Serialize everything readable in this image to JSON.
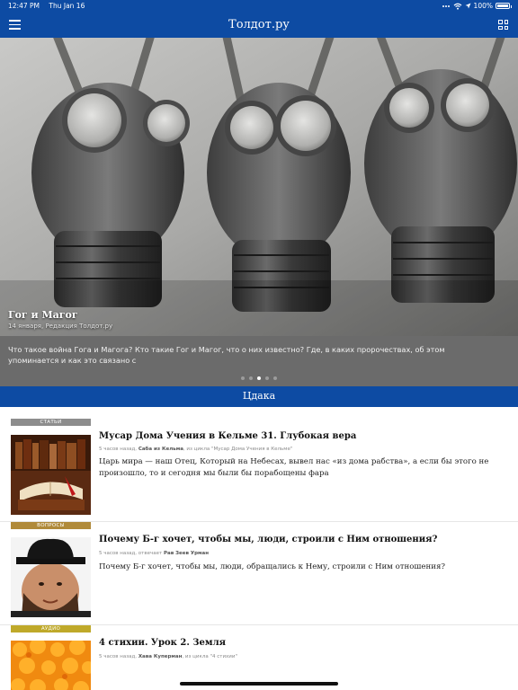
{
  "status_bar": {
    "time": "12:47 PM",
    "date": "Thu Jan 16",
    "battery": "100%"
  },
  "nav": {
    "title": "Толдот.ру",
    "menu_icon": "hamburger-icon",
    "grid_icon": "grid-icon"
  },
  "hero": {
    "title": "Гог и Магог",
    "subtitle": "14 января, Редакция Толдот.ру",
    "description": "Что такое война Гога и Магога? Кто такие Гог и Магог, что о них известно? Где, в каких пророчествах, об этом упоминается и как это связано с",
    "slides_total": 5,
    "slide_active": 3
  },
  "section": {
    "title": "Цдака"
  },
  "articles": [
    {
      "tag": "СТАТЬИ",
      "tag_color": "#8d8d8d",
      "title": "Мусар Дома Учения в Кельме 31. Глубокая вера",
      "meta_time": "5 часов назад,",
      "meta_author": "Саба из Кельма",
      "meta_series": ", из цикла \"Мусар Дома Учения в Кельме\"",
      "excerpt": "Царь мира — наш Отец, Который на Небесах, вывел нас «из дома рабства», а если бы этого не произошло, то и сегодня мы были бы порабощены фара"
    },
    {
      "tag": "ВОПРОСЫ",
      "tag_color": "#b08a3a",
      "title": "Почему Б-г хочет, чтобы мы, люди, строили с Ним отношения?",
      "meta_time": "5 часов назад, отвечает",
      "meta_author": "Рав Зеев Урман",
      "meta_series": "",
      "excerpt": "Почему Б-г хочет, чтобы мы, люди, обращались к Нему, строили с Ним отношения?"
    },
    {
      "tag": "АУДИО",
      "tag_color": "#bfa92a",
      "title": "4 стихии. Урок 2. Земля",
      "meta_time": "5 часов назад,",
      "meta_author": "Хава Куперман",
      "meta_series": ", из цикла \"4 стихии\"",
      "excerpt": ""
    }
  ]
}
